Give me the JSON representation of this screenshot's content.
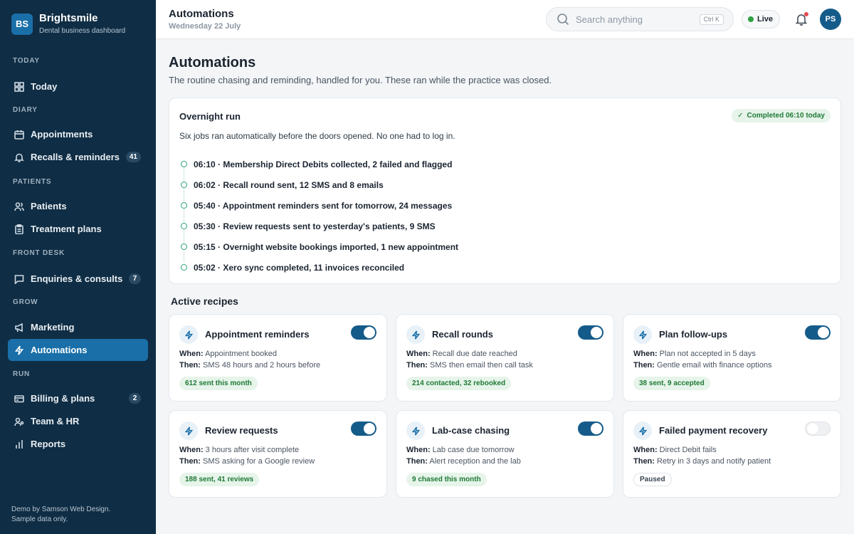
{
  "brand": {
    "logo": "BS",
    "name": "Brightsmile",
    "subtitle": "Dental business dashboard"
  },
  "sidebar": {
    "sections": [
      {
        "heading": "TODAY",
        "items": [
          {
            "label": "Today",
            "icon": "grid-icon"
          }
        ]
      },
      {
        "heading": "DIARY",
        "items": [
          {
            "label": "Appointments",
            "icon": "calendar-icon"
          },
          {
            "label": "Recalls & reminders",
            "icon": "bell-icon",
            "badge": "41"
          }
        ]
      },
      {
        "heading": "PATIENTS",
        "items": [
          {
            "label": "Patients",
            "icon": "users-icon"
          },
          {
            "label": "Treatment plans",
            "icon": "clipboard-icon"
          }
        ]
      },
      {
        "heading": "FRONT DESK",
        "items": [
          {
            "label": "Enquiries & consults",
            "icon": "chat-icon",
            "badge": "7"
          }
        ]
      },
      {
        "heading": "GROW",
        "items": [
          {
            "label": "Marketing",
            "icon": "megaphone-icon"
          },
          {
            "label": "Automations",
            "icon": "bolt-icon",
            "active": true
          }
        ]
      },
      {
        "heading": "RUN",
        "items": [
          {
            "label": "Billing & plans",
            "icon": "card-icon",
            "badge": "2"
          },
          {
            "label": "Team & HR",
            "icon": "team-icon"
          },
          {
            "label": "Reports",
            "icon": "bars-icon"
          }
        ]
      }
    ],
    "footer_line1": "Demo by Samson Web Design.",
    "footer_line2": "Sample data only."
  },
  "topbar": {
    "title": "Automations",
    "date": "Wednesday 22 July",
    "search_placeholder": "Search anything",
    "search_shortcut": "Ctrl K",
    "live_label": "Live",
    "avatar": "PS"
  },
  "colors": {
    "sidebar_bg": "#0f2d44",
    "accent": "#1a6fa8",
    "success": "#1f7a35",
    "success_bg": "#e6f4ea"
  },
  "page": {
    "title": "Automations",
    "description": "The routine chasing and reminding, handled for you. These ran while the practice was closed."
  },
  "overnight": {
    "title": "Overnight run",
    "status": "Completed 06:10 today",
    "description": "Six jobs ran automatically before the doors opened. No one had to log in.",
    "events": [
      "06:10 · Membership Direct Debits collected, 2 failed and flagged",
      "06:02 · Recall round sent, 12 SMS and 8 emails",
      "05:40 · Appointment reminders sent for tomorrow, 24 messages",
      "05:30 · Review requests sent to yesterday's patients, 9 SMS",
      "05:15 · Overnight website bookings imported, 1 new appointment",
      "05:02 · Xero sync completed, 11 invoices reconciled"
    ]
  },
  "recipes": {
    "title": "Active recipes",
    "when_label": "When:",
    "then_label": "Then:",
    "items": [
      {
        "title": "Appointment reminders",
        "when": "Appointment booked",
        "then": "SMS 48 hours and 2 hours before",
        "stat": "612 sent this month",
        "enabled": true
      },
      {
        "title": "Recall rounds",
        "when": "Recall due date reached",
        "then": "SMS then email then call task",
        "stat": "214 contacted, 32 rebooked",
        "enabled": true
      },
      {
        "title": "Plan follow-ups",
        "when": "Plan not accepted in 5 days",
        "then": "Gentle email with finance options",
        "stat": "38 sent, 9 accepted",
        "enabled": true
      },
      {
        "title": "Review requests",
        "when": "3 hours after visit complete",
        "then": "SMS asking for a Google review",
        "stat": "188 sent, 41 reviews",
        "enabled": true
      },
      {
        "title": "Lab-case chasing",
        "when": "Lab case due tomorrow",
        "then": "Alert reception and the lab",
        "stat": "9 chased this month",
        "enabled": true
      },
      {
        "title": "Failed payment recovery",
        "when": "Direct Debit fails",
        "then": "Retry in 3 days and notify patient",
        "stat": "Paused",
        "enabled": false
      }
    ]
  }
}
